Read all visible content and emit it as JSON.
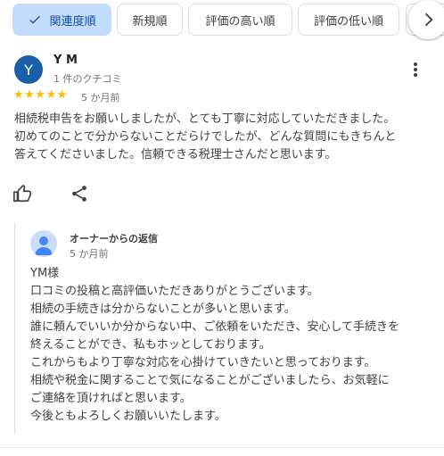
{
  "sort_chips": {
    "relevance": "関連度順",
    "newest": "新規順",
    "highest": "評価の高い順",
    "lowest": "評価の低い順"
  },
  "review": {
    "avatar_letter": "Y",
    "author": "Y M",
    "author_meta": "1 件のクチコミ",
    "rating": 5,
    "stars": "★★★★★",
    "time": "5 か月前",
    "text_lines": [
      "相続税申告をお願いしましたが、とても丁寧に対応していただきました。",
      "初めてのことで分からないことだらけでしたが、どんな質問にもきちんと",
      "答えてくださいました。信頼できる税理士さんだと思います。"
    ]
  },
  "owner_reply": {
    "label": "オーナーからの返信",
    "time": "5 か月前",
    "text_lines": [
      "YM様",
      "口コミの投稿と高評価いただきありがとうございます。",
      "相続の手続きは分からないことが多いと思います。",
      "誰に頼んでいいか分からない中、ご依頼をいただき、安心して手続きを",
      "終えることができ、私もホッとしております。",
      "これからもより丁寧な対応を心掛けていきたいと思っております。",
      "相続や税金に関することで気になることがございましたら、お気軽に",
      "ご連絡を頂ければと思います。",
      "今後ともよろしくお願いいたします。"
    ]
  },
  "colors": {
    "accent_chip_bg": "#c2dcfb",
    "star": "#fbbc04",
    "avatar_bg": "#1a5fa8"
  },
  "icons": {
    "chip_check": "check-icon",
    "next": "chevron-right-icon",
    "menu": "more-vert-icon",
    "like": "thumb-up-icon",
    "share": "share-icon",
    "owner_avatar": "person-icon"
  }
}
